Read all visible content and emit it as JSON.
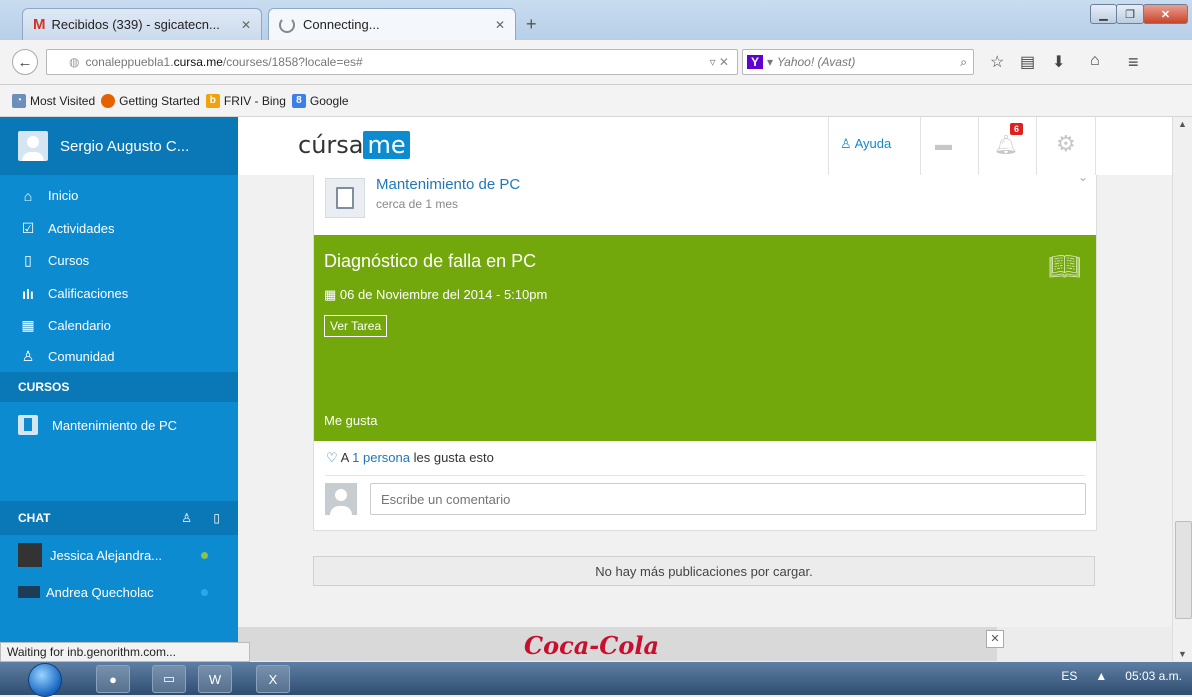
{
  "browser": {
    "tabs": [
      {
        "label": "Recibidos (339) - sgicatecn..."
      },
      {
        "label": "Connecting..."
      }
    ],
    "url_prefix": "conaleppuebla1.",
    "url_domain": "cursa.me",
    "url_path": "/courses/1858?locale=es#",
    "search_placeholder": "Yahoo! (Avast)",
    "bookmarks": [
      "Most Visited",
      "Getting Started",
      "FRIV - Bing",
      "Google"
    ],
    "status_text": "Waiting for inb.genorithm.com..."
  },
  "sidebar": {
    "user_name": "Sergio Augusto C...",
    "nav": [
      {
        "label": "Inicio",
        "icon": "home-icon"
      },
      {
        "label": "Actividades",
        "icon": "checkbox-icon"
      },
      {
        "label": "Cursos",
        "icon": "book-icon"
      },
      {
        "label": "Calificaciones",
        "icon": "bar-chart-icon"
      },
      {
        "label": "Calendario",
        "icon": "calendar-icon"
      },
      {
        "label": "Comunidad",
        "icon": "user-icon"
      }
    ],
    "courses_heading": "CURSOS",
    "courses": [
      "Mantenimiento de PC"
    ],
    "chat_heading": "CHAT",
    "chat": [
      {
        "name": "Jessica Alejandra...",
        "status_color": "#8bc34a"
      },
      {
        "name": "Andrea Quecholac",
        "status_color": "#29a8f0"
      }
    ]
  },
  "header": {
    "logo_text": "cúrsa",
    "logo_badge": "me",
    "help_label": "Ayuda",
    "notification_count": "6"
  },
  "post": {
    "course_title": "Mantenimiento de PC",
    "time_ago": "cerca de 1 mes",
    "task_title": "Diagnóstico de falla en PC",
    "task_date": "06 de Noviembre del 2014 - 5:10pm",
    "task_button": "Ver Tarea",
    "like_label": "Me gusta",
    "likes_prefix": "A",
    "likes_link": "1 persona",
    "likes_suffix": "les gusta esto",
    "comment_placeholder": "Escribe un comentario",
    "accent_color": "#72a80b"
  },
  "feed": {
    "no_more": "No hay más publicaciones por cargar."
  },
  "taskbar": {
    "lang": "ES",
    "time": "05:03 a.m."
  }
}
